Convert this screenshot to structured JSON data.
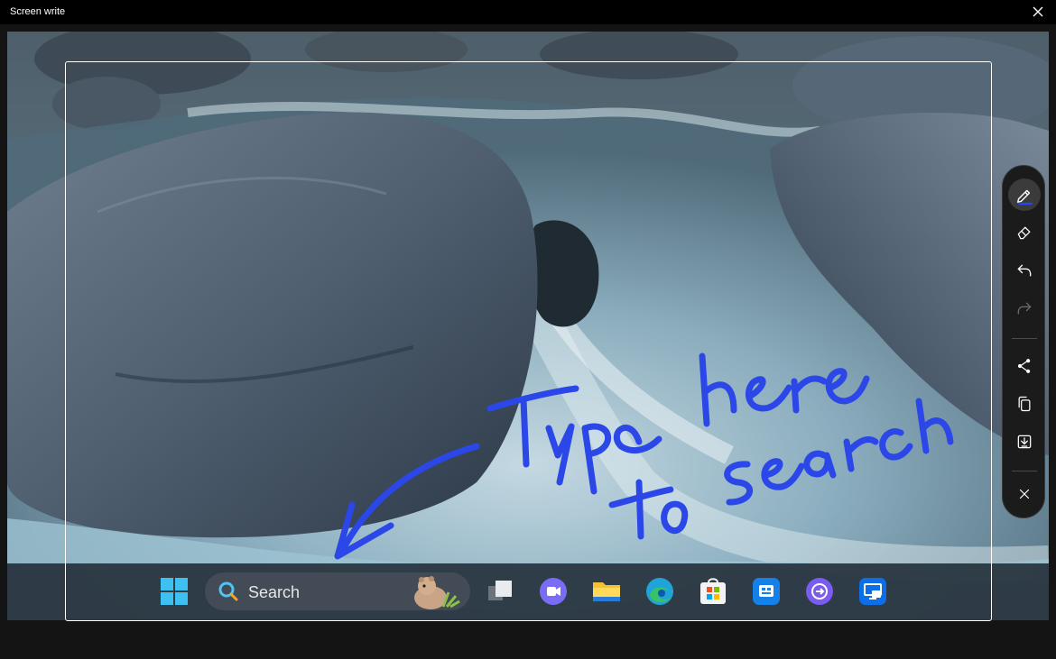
{
  "window": {
    "title": "Screen write"
  },
  "taskbar": {
    "search_label": "Search"
  },
  "toolbar": {
    "tools": [
      "pen-icon",
      "eraser-icon",
      "undo-icon",
      "redo-icon",
      "share-icon",
      "copy-icon",
      "save-icon",
      "close-icon"
    ],
    "active_tool": "pen-icon",
    "ink_color": "#2b47e8"
  },
  "handwriting": {
    "text": "Type here to search"
  },
  "colors": {
    "accent": "#2b47e8",
    "titlebar": "#000000",
    "toolbar_bg": "#1b1b1b"
  }
}
